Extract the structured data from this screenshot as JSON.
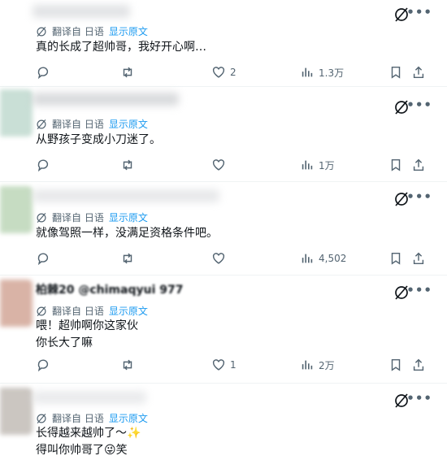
{
  "translation_bar": {
    "label": "翻译自 日语",
    "show_original": "显示原文"
  },
  "posts": [
    {
      "header": "",
      "text": "真的长成了超帅哥，我好开心啊…",
      "replies": "",
      "reposts": "",
      "likes": "2",
      "views": "1.3万"
    },
    {
      "header": "",
      "text": "从野孩子变成小刀迷了。",
      "replies": "",
      "reposts": "",
      "likes": "",
      "views": "1万"
    },
    {
      "header": "",
      "text": "就像驾照一样，没满足资格条件吧。",
      "replies": "",
      "reposts": "",
      "likes": "",
      "views": "4,502"
    },
    {
      "header": "柏棘20 @chimaqyui 977",
      "text": "喂！超帅啊你这家伙\n你长大了嘛",
      "replies": "",
      "reposts": "",
      "likes": "1",
      "views": "2万"
    },
    {
      "header": "",
      "text": "长得越来越帅了～✨\n得叫你帅哥了😜笑",
      "replies": "",
      "reposts": "",
      "likes": "",
      "views": ""
    }
  ],
  "colors": {
    "text": "#0f1419",
    "muted": "#536471",
    "link": "#1d9bf0",
    "divider": "#eff3f4"
  },
  "icons": [
    "grok-icon",
    "more-icon",
    "translate-icon",
    "reply-icon",
    "repost-icon",
    "like-icon",
    "views-icon",
    "bookmark-icon",
    "share-icon"
  ]
}
